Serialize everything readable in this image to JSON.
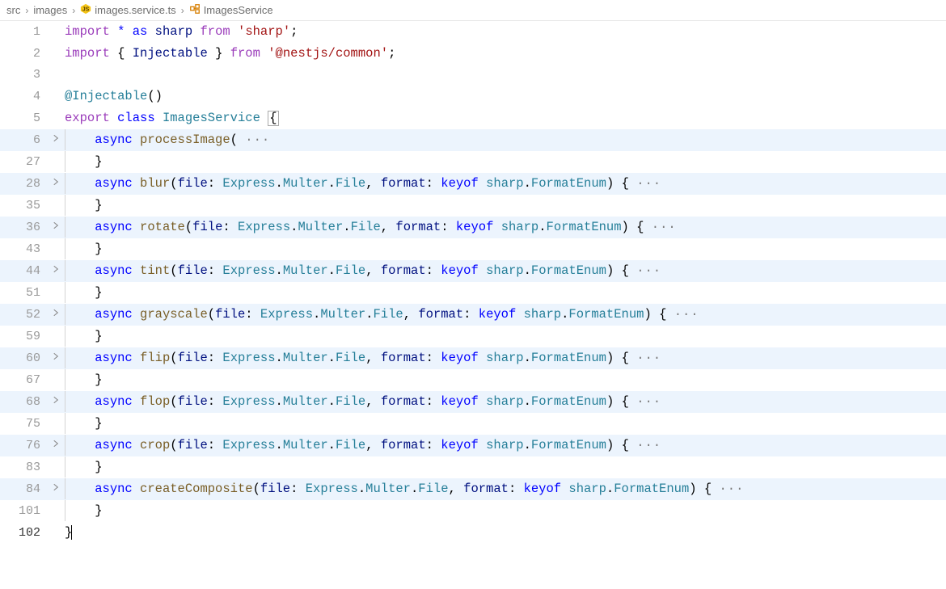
{
  "breadcrumb": {
    "items": [
      {
        "label": "src",
        "icon": null
      },
      {
        "label": "images",
        "icon": null
      },
      {
        "label": "images.service.ts",
        "icon": "ts"
      },
      {
        "label": "ImagesService",
        "icon": "class"
      }
    ]
  },
  "code": {
    "import1": {
      "import": "import",
      "star": "*",
      "as": "as",
      "sharp": "sharp",
      "from": "from",
      "module": "'sharp'"
    },
    "import2": {
      "import": "import",
      "injectable": "Injectable",
      "from": "from",
      "module": "'@nestjs/common'"
    },
    "decorator": "@Injectable",
    "export": "export",
    "class": "class",
    "className": "ImagesService",
    "async": "async",
    "keyof": "keyof",
    "methods": {
      "processImage": "processImage",
      "blur": "blur",
      "rotate": "rotate",
      "tint": "tint",
      "grayscale": "grayscale",
      "flip": "flip",
      "flop": "flop",
      "crop": "crop",
      "createComposite": "createComposite"
    },
    "param": {
      "file": "file",
      "format": "format",
      "express": "Express",
      "multer": "Multer",
      "fileType": "File",
      "sharp": "sharp",
      "formatEnum": "FormatEnum"
    },
    "braceOpen": "{",
    "braceClose": "}",
    "parenOpen": "(",
    "parenClose": ")",
    "comma": ",",
    "colon": ":",
    "dot": ".",
    "semi": ";",
    "ellipsis": "···"
  },
  "lineNumbers": {
    "l1": "1",
    "l2": "2",
    "l3": "3",
    "l4": "4",
    "l5": "5",
    "l6": "6",
    "l27": "27",
    "l28": "28",
    "l35": "35",
    "l36": "36",
    "l43": "43",
    "l44": "44",
    "l51": "51",
    "l52": "52",
    "l59": "59",
    "l60": "60",
    "l67": "67",
    "l68": "68",
    "l75": "75",
    "l76": "76",
    "l83": "83",
    "l84": "84",
    "l101": "101",
    "l102": "102"
  }
}
